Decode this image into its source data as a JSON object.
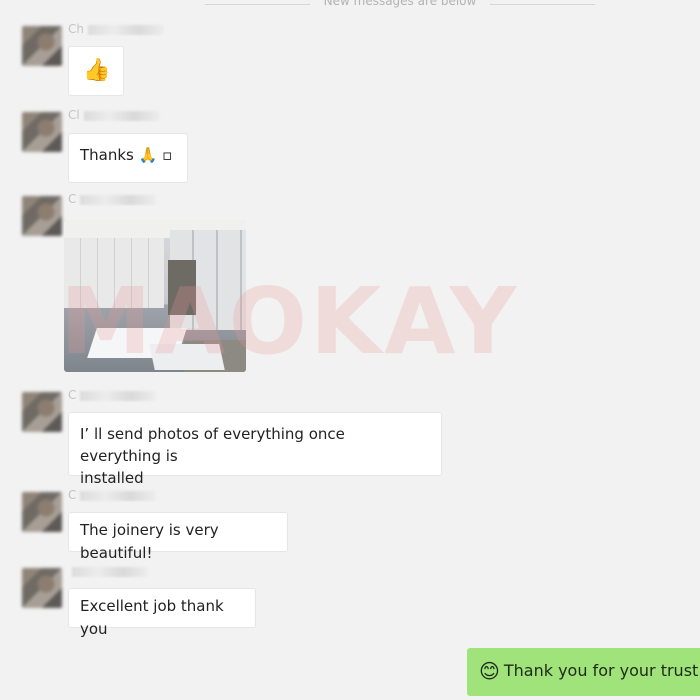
{
  "divider": {
    "text": "New messages are below"
  },
  "messages": [
    {
      "sender": "Ch",
      "text": "👍"
    },
    {
      "sender": "Cl",
      "text": "Thanks 🙏 ▫"
    },
    {
      "sender": "C",
      "text": ""
    },
    {
      "sender": "C",
      "text_line1": "I’ ll send photos of everything once everything is",
      "text_line2": "installed"
    },
    {
      "sender": "C",
      "text": "The joinery is very beautiful!"
    },
    {
      "sender": "",
      "text": "Excellent job thank you"
    }
  ],
  "outgoing": {
    "emoji": "😊",
    "text": "Thank you for your trust in"
  },
  "watermark": "MAOKAY",
  "colors": {
    "background": "#f2f2f2",
    "bubble_in": "#ffffff",
    "bubble_out": "#9fe37a",
    "watermark": "#ec9696"
  }
}
